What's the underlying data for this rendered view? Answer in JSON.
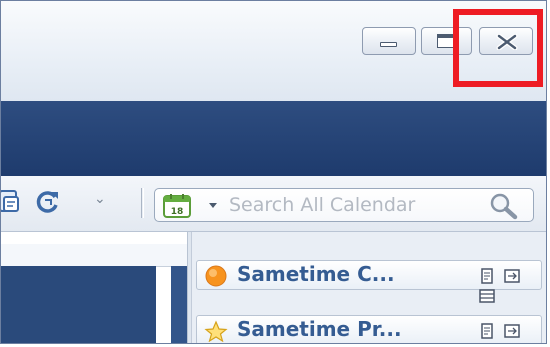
{
  "window_controls": {
    "minimize": {
      "icon": "minimize-icon"
    },
    "restore": {
      "icon": "restore-icon"
    },
    "close": {
      "icon": "close-icon"
    }
  },
  "annotation": {
    "color": "#ee1c24",
    "target": "close-button"
  },
  "toolbar": {
    "icons": [
      "attachment-icon",
      "refresh-icon",
      "overflow-chevron-icon"
    ],
    "search": {
      "calendar_icon": "calendar-icon",
      "calendar_day": "18",
      "placeholder": "Search All Calendar",
      "value": "",
      "search_icon": "magnifier-icon"
    }
  },
  "sidebar": {
    "items": [
      {
        "label": "Sametime C...",
        "icon": "sametime-orange-icon"
      },
      {
        "label": "Sametime Pr...",
        "icon": "star-icon"
      }
    ],
    "tools": [
      "document-icon",
      "pane-arrow-icon",
      "pane-list-icon"
    ]
  },
  "colors": {
    "title_bar": "#e6edf5",
    "header_band": "#2b4a7c",
    "highlight": "#ee1c24",
    "sidebar_title": "#355c92"
  }
}
